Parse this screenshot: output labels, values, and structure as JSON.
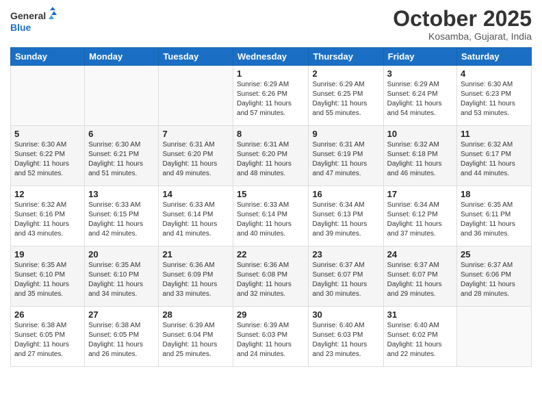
{
  "header": {
    "logo_line1": "General",
    "logo_line2": "Blue",
    "month": "October 2025",
    "location": "Kosamba, Gujarat, India"
  },
  "weekdays": [
    "Sunday",
    "Monday",
    "Tuesday",
    "Wednesday",
    "Thursday",
    "Friday",
    "Saturday"
  ],
  "weeks": [
    [
      {
        "day": "",
        "info": ""
      },
      {
        "day": "",
        "info": ""
      },
      {
        "day": "",
        "info": ""
      },
      {
        "day": "1",
        "info": "Sunrise: 6:29 AM\nSunset: 6:26 PM\nDaylight: 11 hours\nand 57 minutes."
      },
      {
        "day": "2",
        "info": "Sunrise: 6:29 AM\nSunset: 6:25 PM\nDaylight: 11 hours\nand 55 minutes."
      },
      {
        "day": "3",
        "info": "Sunrise: 6:29 AM\nSunset: 6:24 PM\nDaylight: 11 hours\nand 54 minutes."
      },
      {
        "day": "4",
        "info": "Sunrise: 6:30 AM\nSunset: 6:23 PM\nDaylight: 11 hours\nand 53 minutes."
      }
    ],
    [
      {
        "day": "5",
        "info": "Sunrise: 6:30 AM\nSunset: 6:22 PM\nDaylight: 11 hours\nand 52 minutes."
      },
      {
        "day": "6",
        "info": "Sunrise: 6:30 AM\nSunset: 6:21 PM\nDaylight: 11 hours\nand 51 minutes."
      },
      {
        "day": "7",
        "info": "Sunrise: 6:31 AM\nSunset: 6:20 PM\nDaylight: 11 hours\nand 49 minutes."
      },
      {
        "day": "8",
        "info": "Sunrise: 6:31 AM\nSunset: 6:20 PM\nDaylight: 11 hours\nand 48 minutes."
      },
      {
        "day": "9",
        "info": "Sunrise: 6:31 AM\nSunset: 6:19 PM\nDaylight: 11 hours\nand 47 minutes."
      },
      {
        "day": "10",
        "info": "Sunrise: 6:32 AM\nSunset: 6:18 PM\nDaylight: 11 hours\nand 46 minutes."
      },
      {
        "day": "11",
        "info": "Sunrise: 6:32 AM\nSunset: 6:17 PM\nDaylight: 11 hours\nand 44 minutes."
      }
    ],
    [
      {
        "day": "12",
        "info": "Sunrise: 6:32 AM\nSunset: 6:16 PM\nDaylight: 11 hours\nand 43 minutes."
      },
      {
        "day": "13",
        "info": "Sunrise: 6:33 AM\nSunset: 6:15 PM\nDaylight: 11 hours\nand 42 minutes."
      },
      {
        "day": "14",
        "info": "Sunrise: 6:33 AM\nSunset: 6:14 PM\nDaylight: 11 hours\nand 41 minutes."
      },
      {
        "day": "15",
        "info": "Sunrise: 6:33 AM\nSunset: 6:14 PM\nDaylight: 11 hours\nand 40 minutes."
      },
      {
        "day": "16",
        "info": "Sunrise: 6:34 AM\nSunset: 6:13 PM\nDaylight: 11 hours\nand 39 minutes."
      },
      {
        "day": "17",
        "info": "Sunrise: 6:34 AM\nSunset: 6:12 PM\nDaylight: 11 hours\nand 37 minutes."
      },
      {
        "day": "18",
        "info": "Sunrise: 6:35 AM\nSunset: 6:11 PM\nDaylight: 11 hours\nand 36 minutes."
      }
    ],
    [
      {
        "day": "19",
        "info": "Sunrise: 6:35 AM\nSunset: 6:10 PM\nDaylight: 11 hours\nand 35 minutes."
      },
      {
        "day": "20",
        "info": "Sunrise: 6:35 AM\nSunset: 6:10 PM\nDaylight: 11 hours\nand 34 minutes."
      },
      {
        "day": "21",
        "info": "Sunrise: 6:36 AM\nSunset: 6:09 PM\nDaylight: 11 hours\nand 33 minutes."
      },
      {
        "day": "22",
        "info": "Sunrise: 6:36 AM\nSunset: 6:08 PM\nDaylight: 11 hours\nand 32 minutes."
      },
      {
        "day": "23",
        "info": "Sunrise: 6:37 AM\nSunset: 6:07 PM\nDaylight: 11 hours\nand 30 minutes."
      },
      {
        "day": "24",
        "info": "Sunrise: 6:37 AM\nSunset: 6:07 PM\nDaylight: 11 hours\nand 29 minutes."
      },
      {
        "day": "25",
        "info": "Sunrise: 6:37 AM\nSunset: 6:06 PM\nDaylight: 11 hours\nand 28 minutes."
      }
    ],
    [
      {
        "day": "26",
        "info": "Sunrise: 6:38 AM\nSunset: 6:05 PM\nDaylight: 11 hours\nand 27 minutes."
      },
      {
        "day": "27",
        "info": "Sunrise: 6:38 AM\nSunset: 6:05 PM\nDaylight: 11 hours\nand 26 minutes."
      },
      {
        "day": "28",
        "info": "Sunrise: 6:39 AM\nSunset: 6:04 PM\nDaylight: 11 hours\nand 25 minutes."
      },
      {
        "day": "29",
        "info": "Sunrise: 6:39 AM\nSunset: 6:03 PM\nDaylight: 11 hours\nand 24 minutes."
      },
      {
        "day": "30",
        "info": "Sunrise: 6:40 AM\nSunset: 6:03 PM\nDaylight: 11 hours\nand 23 minutes."
      },
      {
        "day": "31",
        "info": "Sunrise: 6:40 AM\nSunset: 6:02 PM\nDaylight: 11 hours\nand 22 minutes."
      },
      {
        "day": "",
        "info": ""
      }
    ]
  ]
}
